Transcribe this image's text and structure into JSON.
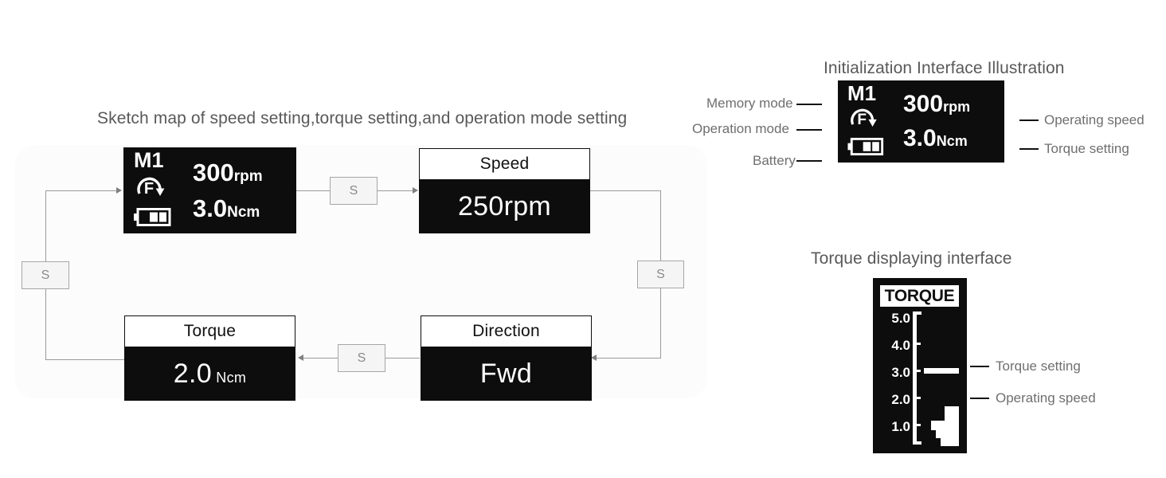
{
  "flow": {
    "title": "Sketch map of speed setting,torque setting,and operation mode setting",
    "step_button_label": "S",
    "device": {
      "memory_mode": "M1",
      "direction_letter": "F",
      "speed_value": "300",
      "speed_unit": "rpm",
      "torque_value": "3.0",
      "torque_unit": "Ncm"
    },
    "boxes": [
      {
        "header": "Speed",
        "value": "250rpm"
      },
      {
        "header": "Direction",
        "value": "Fwd"
      },
      {
        "header": "Torque",
        "value": "2.0",
        "value_unit": "Ncm"
      }
    ]
  },
  "init_panel": {
    "title": "Initialization Interface Illustration",
    "display": {
      "memory_mode": "M1",
      "direction_letter": "F",
      "speed_value": "300",
      "speed_unit": "rpm",
      "torque_value": "3.0",
      "torque_unit": "Ncm"
    },
    "left_labels": [
      "Memory mode",
      "Operation mode",
      "Battery"
    ],
    "right_labels": [
      "Operating speed",
      "Torque setting"
    ]
  },
  "torque_panel": {
    "title": "Torque displaying interface",
    "gauge_header": "TORQUE",
    "scale_labels": [
      "5.0",
      "4.0",
      "3.0",
      "2.0",
      "1.0"
    ],
    "right_labels": [
      "Torque setting",
      "Operating speed"
    ],
    "torque_setting_marker_value": "3.0",
    "operating_speed_bar_peak": "1.4"
  },
  "colors": {
    "lcd_background": "#0d0d0d",
    "lcd_foreground": "#ffffff",
    "title_text": "#595959",
    "label_text": "#6f6f6f",
    "connector": "#9a9a9a",
    "step_box_fill": "#f5f5f5",
    "step_box_border": "#a6a6a6",
    "leader_line": "#111111"
  }
}
